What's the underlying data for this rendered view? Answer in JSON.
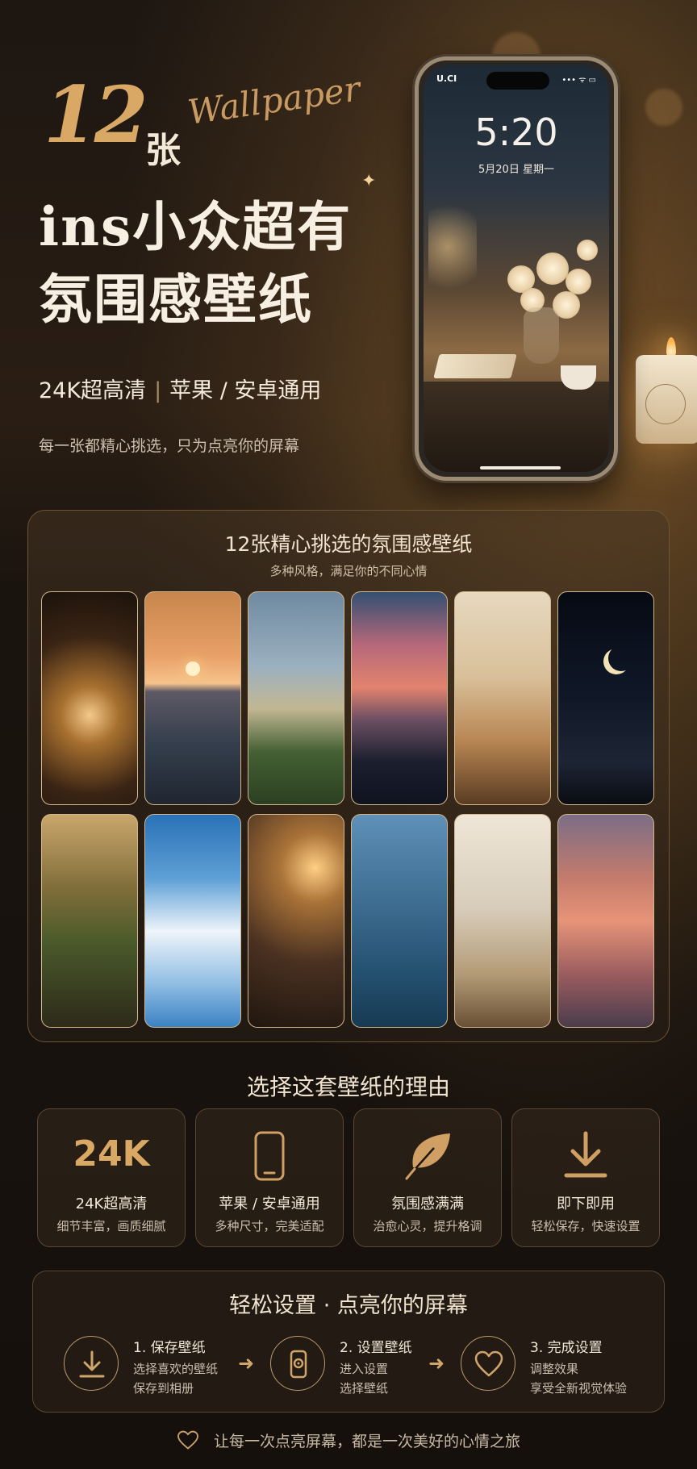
{
  "hero": {
    "count": "12",
    "count_unit": "张",
    "script_word": "Wallpaper",
    "title_line1": "ins小众超有",
    "title_line2": "氛围感壁纸",
    "feature_a": "24K超高清",
    "feature_separator": "|",
    "feature_b": "苹果 / 安卓通用",
    "tagline": "每一张都精心挑选，只为点亮你的屏幕"
  },
  "phone": {
    "status_left": "U.CI",
    "status_right": "••• ᯤ ▭",
    "lock_time": "5:20",
    "lock_date": "5月20日 星期一"
  },
  "gallery": {
    "title": "12张精心挑选的氛围感壁纸",
    "subtitle": "多种风格，满足你的不同心情",
    "thumbnails": [
      "cozy-lamp-room",
      "sea-sunset",
      "white-roses",
      "city-sunset",
      "tulips-tea",
      "crescent-moon",
      "flower-balcony",
      "clouds-traffic-light",
      "warm-bedroom",
      "sparkling-sea",
      "window-flowers",
      "pink-clouds"
    ]
  },
  "reasons": {
    "title": "选择这套壁纸的理由",
    "cards": [
      {
        "big": "24K",
        "label": "24K超高清",
        "desc": "细节丰富，画质细腻",
        "icon": "24k-text"
      },
      {
        "label": "苹果 / 安卓通用",
        "desc": "多种尺寸，完美适配",
        "icon": "phone-icon"
      },
      {
        "label": "氛围感满满",
        "desc": "治愈心灵，提升格调",
        "icon": "leaf-icon"
      },
      {
        "label": "即下即用",
        "desc": "轻松保存，快速设置",
        "icon": "download-icon"
      }
    ]
  },
  "steps": {
    "title": "轻松设置 · 点亮你的屏幕",
    "items": [
      {
        "name": "1. 保存壁纸",
        "line1": "选择喜欢的壁纸",
        "line2": "保存到相册",
        "icon": "download-icon"
      },
      {
        "name": "2. 设置壁纸",
        "line1": "进入设置",
        "line2": "选择壁纸",
        "icon": "phone-settings-icon"
      },
      {
        "name": "3. 完成设置",
        "line1": "调整效果",
        "line2": "享受全新视觉体验",
        "icon": "heart-icon"
      }
    ],
    "arrow": "➜"
  },
  "footer": {
    "text": "让每一次点亮屏幕，都是一次美好的心情之旅",
    "icon": "heart-icon"
  },
  "colors": {
    "accent_gold": "#d9a865",
    "background": "#17110c",
    "card_border": "#5c4631"
  }
}
